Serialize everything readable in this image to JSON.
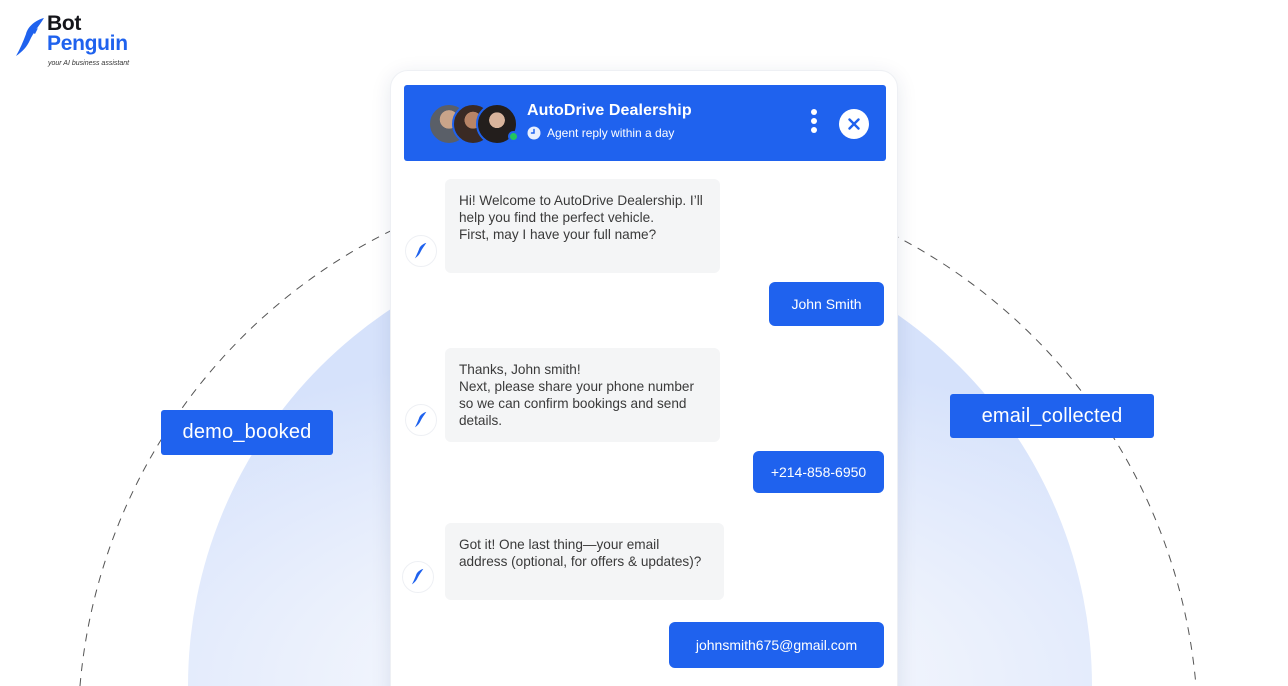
{
  "brand": {
    "name_line1": "Bot",
    "name_line2": "Penguin",
    "tagline": "your AI business assistant",
    "accent": "#1f62ee"
  },
  "tags": {
    "left": "demo_booked",
    "right": "email_collected"
  },
  "chat": {
    "header": {
      "title": "AutoDrive Dealership",
      "subtitle": "Agent reply within a day",
      "status": "online",
      "icons": [
        "clock-icon",
        "more-options-icon",
        "close-icon"
      ]
    },
    "messages": [
      {
        "from": "bot",
        "text": "   Hi! Welcome to AutoDrive Dealership. I’ll help you find the perfect vehicle.\n First, may I have your full name?"
      },
      {
        "from": "user",
        "text": "John Smith"
      },
      {
        "from": "bot",
        "text": "Thanks, John smith!\n Next, please share your phone number so we can confirm bookings and send details."
      },
      {
        "from": "user",
        "text": "+214-858-6950"
      },
      {
        "from": "bot",
        "text": "   Got it! One last thing—your email address (optional, for offers & updates)?"
      },
      {
        "from": "user",
        "text": "johnsmith675@gmail.com"
      }
    ]
  }
}
